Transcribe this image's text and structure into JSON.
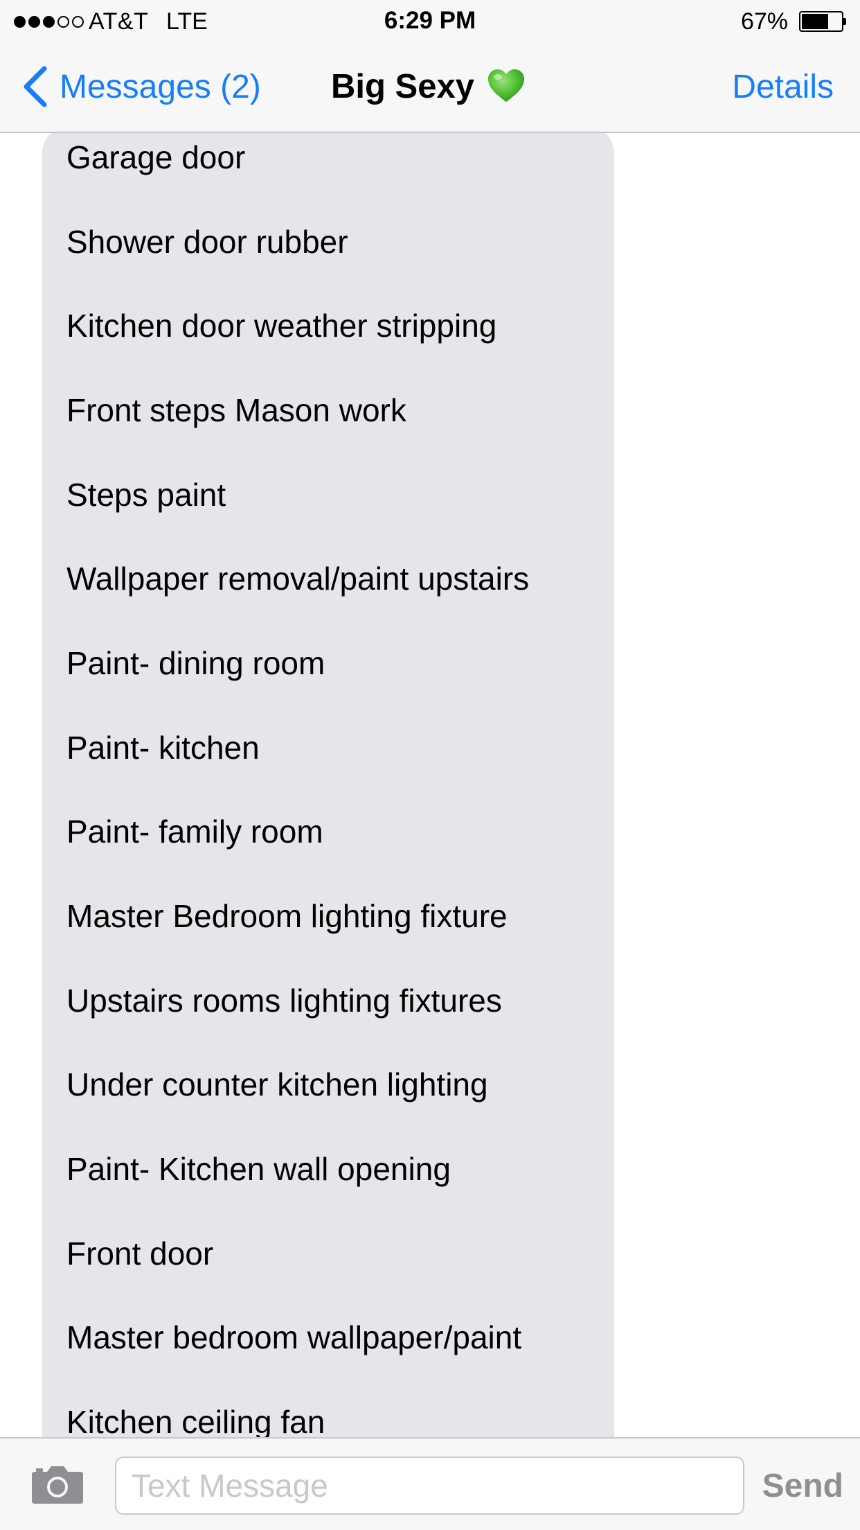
{
  "status_bar": {
    "signal_bars_filled": 3,
    "signal_bars_total": 5,
    "carrier": "AT&T",
    "network": "LTE",
    "time": "6:29 PM",
    "battery_percent_label": "67%",
    "battery_level": 0.67
  },
  "nav_bar": {
    "back_label": "Messages (2)",
    "title": "Big Sexy",
    "title_emoji": "green-heart-icon",
    "details_label": "Details"
  },
  "thread": {
    "bubble_color": "#e5e5ea",
    "message_lines": [
      "Garage door",
      "Shower door rubber",
      "Kitchen door weather stripping",
      "Front steps Mason work",
      "Steps paint",
      "Wallpaper removal/paint upstairs",
      "Paint- dining room",
      "Paint- kitchen",
      "Paint- family room",
      "Master Bedroom lighting fixture",
      "Upstairs rooms lighting fixtures",
      "Under counter kitchen lighting",
      "Paint- Kitchen wall opening",
      "Front door",
      "Master bedroom wallpaper/paint",
      "Kitchen ceiling fan"
    ]
  },
  "input_bar": {
    "camera_icon": "camera-icon",
    "placeholder": "Text Message",
    "value": "",
    "send_label": "Send"
  },
  "colors": {
    "accent": "#147efb",
    "bar_background": "#f7f7f8",
    "send_disabled": "#8e8e93",
    "heart": "#52c234"
  }
}
